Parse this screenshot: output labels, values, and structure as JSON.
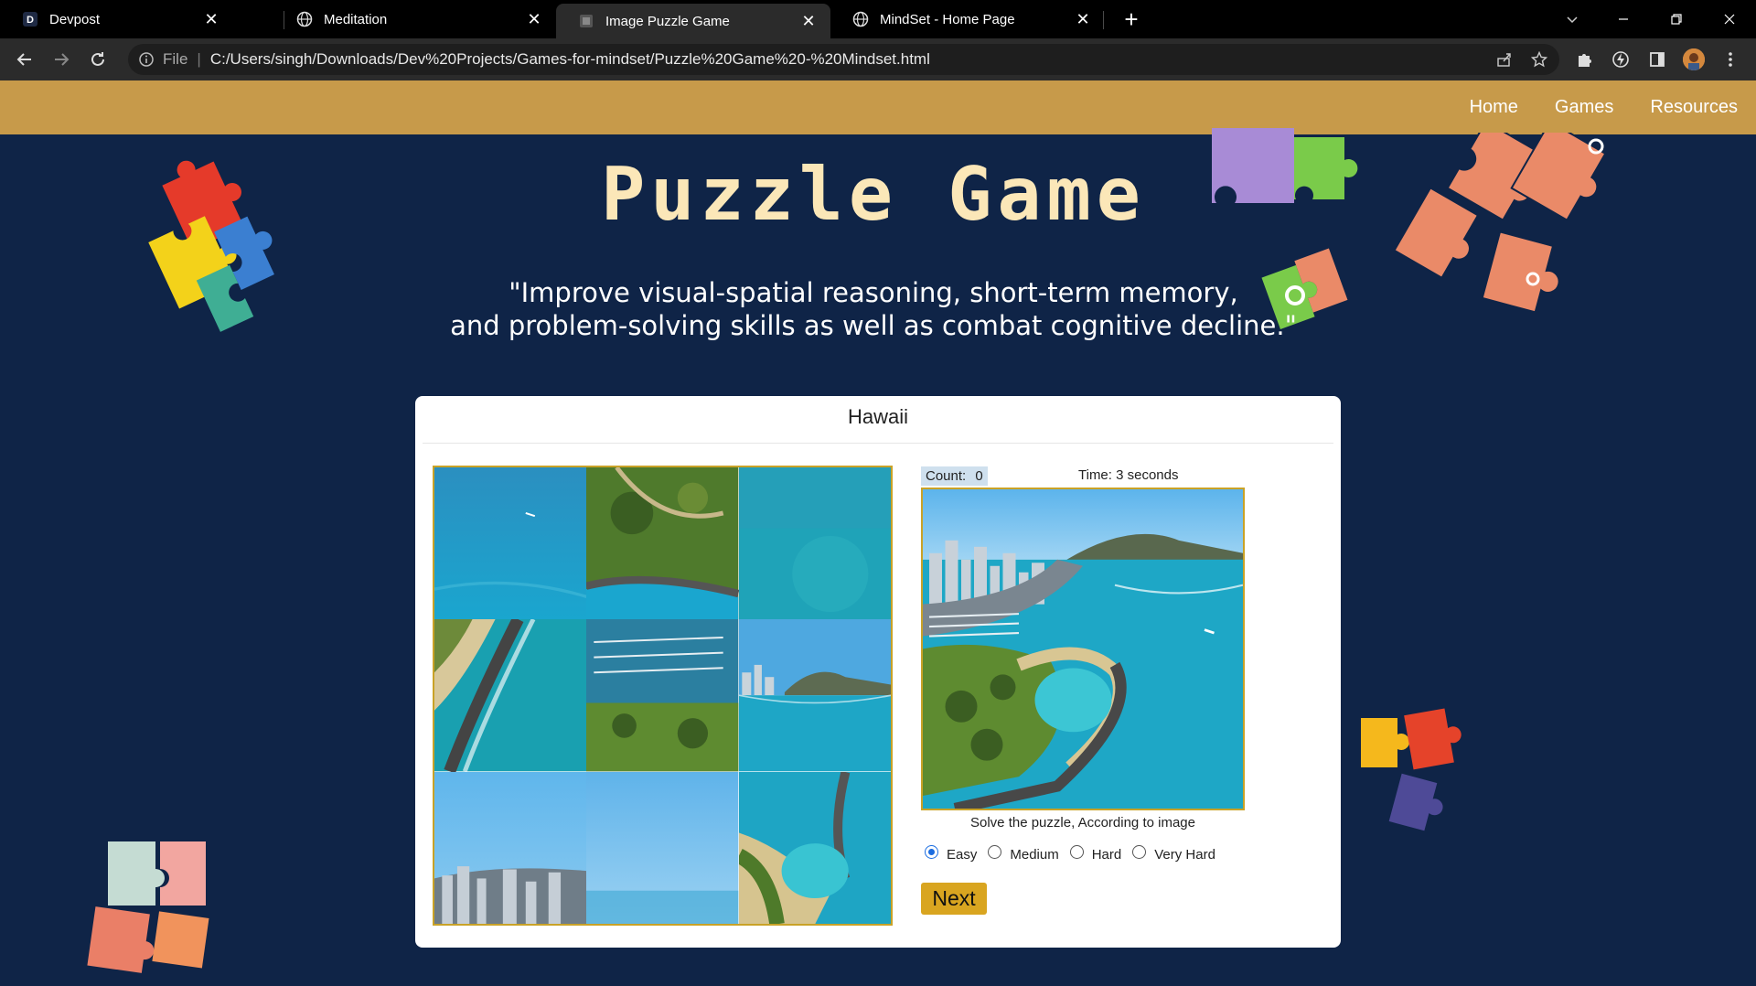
{
  "browser": {
    "tabs": [
      {
        "title": "Devpost",
        "icon": "devpost-icon",
        "active": false
      },
      {
        "title": "Meditation",
        "icon": "globe-icon",
        "active": false
      },
      {
        "title": "Image Puzzle Game",
        "icon": "puzzle-site-icon",
        "active": true
      },
      {
        "title": "MindSet - Home Page",
        "icon": "globe-icon",
        "active": false
      }
    ],
    "address": {
      "scheme_label": "File",
      "url": "C:/Users/singh/Downloads/Dev%20Projects/Games-for-mindset/Puzzle%20Game%20-%20Mindset.html"
    }
  },
  "site": {
    "nav": [
      "Home",
      "Games",
      "Resources"
    ],
    "heading": "Puzzle Game",
    "quote_line1": "\"Improve visual-spatial reasoning, short-term memory,",
    "quote_line2": "and problem-solving skills as well as combat cognitive decline.\""
  },
  "game": {
    "title": "Hawaii",
    "count_label": "Count:",
    "count_value": "0",
    "time_text": "Time: 3 seconds",
    "hint": "Solve the puzzle, According to image",
    "levels": [
      {
        "label": "Easy",
        "selected": true
      },
      {
        "label": "Medium",
        "selected": false
      },
      {
        "label": "Hard",
        "selected": false
      },
      {
        "label": "Very Hard",
        "selected": false
      }
    ],
    "next_label": "Next",
    "grid_size": 3
  },
  "colors": {
    "page_bg": "#0f2447",
    "nav_bg": "#c79a4a",
    "heading": "#fbe7b8",
    "accent": "#d9a520",
    "ocean": "#1d9fc9"
  }
}
